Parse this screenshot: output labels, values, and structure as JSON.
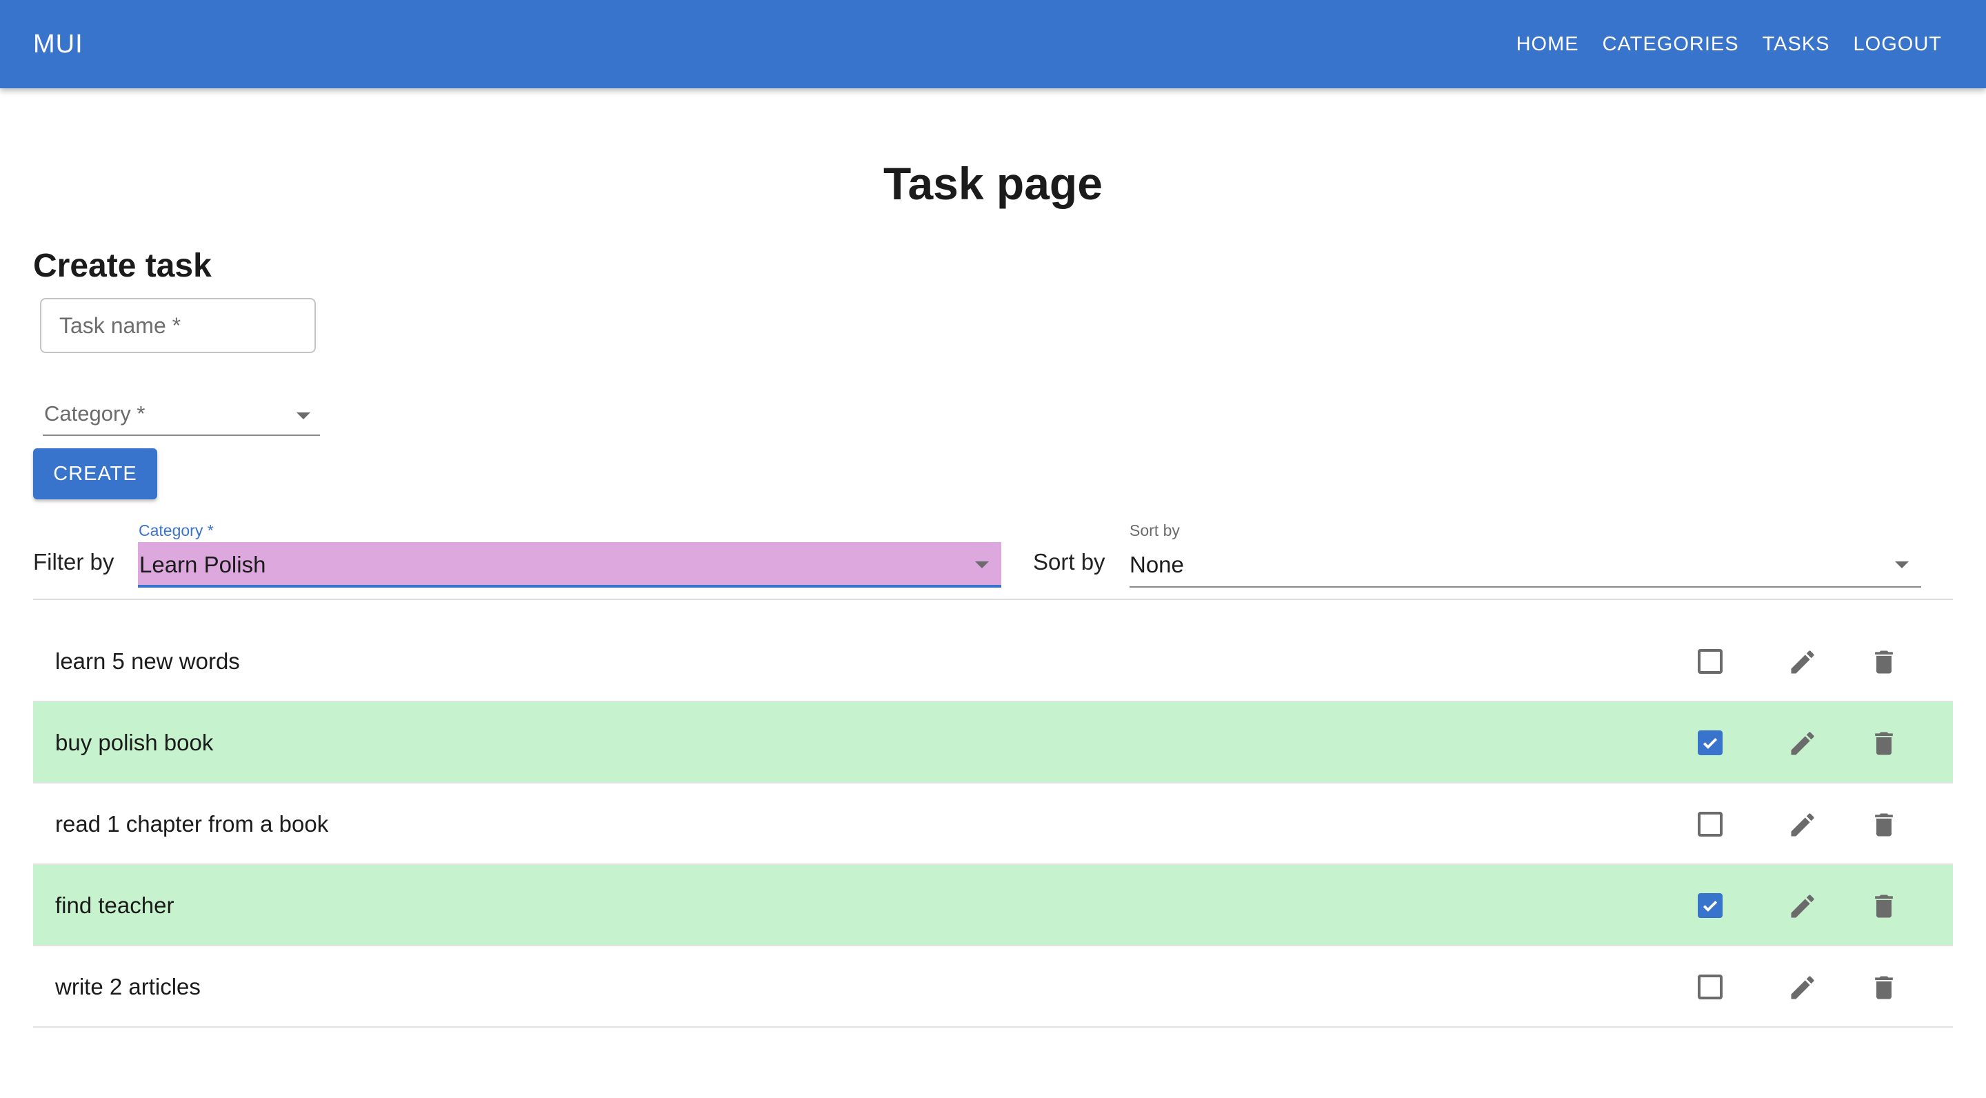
{
  "appbar": {
    "brand": "MUI",
    "nav": [
      "HOME",
      "CATEGORIES",
      "TASKS",
      "LOGOUT"
    ]
  },
  "page": {
    "title": "Task page",
    "create_section_title": "Create task"
  },
  "create_form": {
    "task_name_placeholder": "Task name *",
    "category_label": "Category *",
    "create_button": "CREATE"
  },
  "filter": {
    "label": "Filter by",
    "floating_label": "Category *",
    "selected": "Learn Polish",
    "highlight_color": "#dda8dd"
  },
  "sort": {
    "label": "Sort by",
    "floating_label": "Sort by",
    "selected": "None"
  },
  "colors": {
    "primary": "#3874cb",
    "done_row": "#c6f3cd",
    "icon": "#6b6b6b"
  },
  "tasks": [
    {
      "name": "learn 5 new words",
      "done": false
    },
    {
      "name": "buy polish book",
      "done": true
    },
    {
      "name": "read 1 chapter from a book",
      "done": false
    },
    {
      "name": "find teacher",
      "done": true
    },
    {
      "name": "write 2 articles",
      "done": false
    }
  ]
}
